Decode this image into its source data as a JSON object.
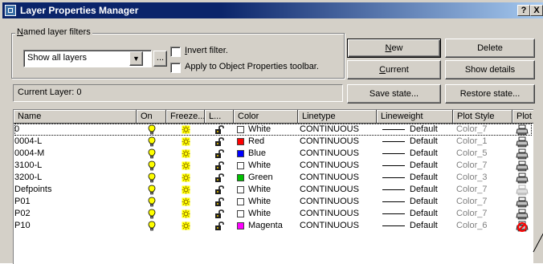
{
  "window": {
    "title": "Layer Properties Manager",
    "help_label": "?",
    "close_label": "X"
  },
  "filters": {
    "group_label": "Named layer filters",
    "selected": "Show all layers",
    "more_label": "...",
    "invert_label": "Invert filter.",
    "apply_label": "Apply to Object Properties toolbar."
  },
  "buttons": {
    "new": "New",
    "delete": "Delete",
    "current": "Current",
    "show_details": "Show details",
    "save_state": "Save state...",
    "restore_state": "Restore state..."
  },
  "current_layer": "Current Layer:  0",
  "columns": [
    "Name",
    "On",
    "Freeze...",
    "L...",
    "Color",
    "Linetype",
    "Lineweight",
    "Plot Style",
    "Plot"
  ],
  "layers": [
    {
      "name": "0",
      "color_name": "White",
      "color_hex": "#ffffff",
      "linetype": "CONTINUOUS",
      "lineweight": "Default",
      "plot_style": "Color_7",
      "plot_icon": "printer-icon"
    },
    {
      "name": "0004-L",
      "color_name": "Red",
      "color_hex": "#ff0000",
      "linetype": "CONTINUOUS",
      "lineweight": "Default",
      "plot_style": "Color_1",
      "plot_icon": "printer-icon"
    },
    {
      "name": "0004-M",
      "color_name": "Blue",
      "color_hex": "#0000ff",
      "linetype": "CONTINUOUS",
      "lineweight": "Default",
      "plot_style": "Color_5",
      "plot_icon": "printer-icon"
    },
    {
      "name": "3100-L",
      "color_name": "White",
      "color_hex": "#ffffff",
      "linetype": "CONTINUOUS",
      "lineweight": "Default",
      "plot_style": "Color_7",
      "plot_icon": "printer-icon"
    },
    {
      "name": "3200-L",
      "color_name": "Green",
      "color_hex": "#00c000",
      "linetype": "CONTINUOUS",
      "lineweight": "Default",
      "plot_style": "Color_3",
      "plot_icon": "printer-icon"
    },
    {
      "name": "Defpoints",
      "color_name": "White",
      "color_hex": "#ffffff",
      "linetype": "CONTINUOUS",
      "lineweight": "Default",
      "plot_style": "Color_7",
      "plot_icon": "printer-disabled-icon"
    },
    {
      "name": "P01",
      "color_name": "White",
      "color_hex": "#ffffff",
      "linetype": "CONTINUOUS",
      "lineweight": "Default",
      "plot_style": "Color_7",
      "plot_icon": "printer-icon"
    },
    {
      "name": "P02",
      "color_name": "White",
      "color_hex": "#ffffff",
      "linetype": "CONTINUOUS",
      "lineweight": "Default",
      "plot_style": "Color_7",
      "plot_icon": "printer-icon"
    },
    {
      "name": "P10",
      "color_name": "Magenta",
      "color_hex": "#ff00ff",
      "linetype": "CONTINUOUS",
      "lineweight": "Default",
      "plot_style": "Color_6",
      "plot_icon": "no-plot-printer-icon"
    }
  ],
  "colors": {
    "titlebar": "#0a246a",
    "face": "#d4d0c8",
    "bulb": "#ffff00",
    "sun": "#ffff00",
    "no_plot": "#ff0000"
  }
}
